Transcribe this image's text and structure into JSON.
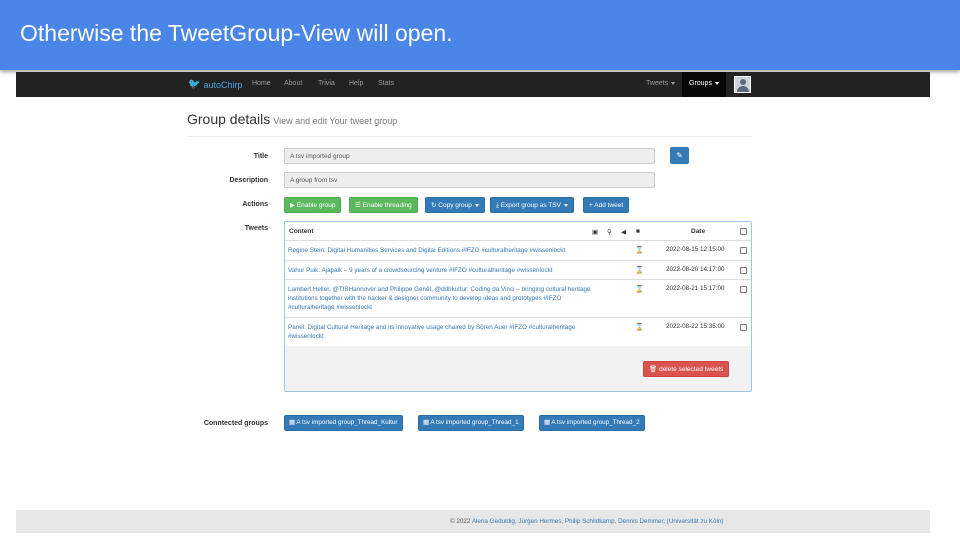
{
  "slide": {
    "title": "Otherwise the TweetGroup-View will open."
  },
  "navbar": {
    "brand": "autoChirp",
    "links": [
      "Home",
      "About",
      "Trivia",
      "Help",
      "Stats"
    ],
    "tweets_menu": "Tweets",
    "groups_menu": "Groups"
  },
  "page": {
    "title": "Group details",
    "subtitle": "View and edit Your tweet group"
  },
  "form": {
    "title_label": "Title",
    "title_value": "A tsv imported group",
    "description_label": "Description",
    "description_value": "A group from tsv",
    "actions_label": "Actions",
    "tweets_label": "Tweets"
  },
  "actions": {
    "enable_group": "Enable group",
    "enable_threading": "Enable threading",
    "copy_group": "Copy group",
    "export_tsv": "Export group as TSV",
    "add_tweet": "Add tweet"
  },
  "tweets_table": {
    "col_content": "Content",
    "col_date": "Date",
    "rows": [
      {
        "content": "Regine Stein: Digital Humanities Services and Digital Editions #IFZO #culturalheritage #wissenlockt",
        "date": "2022-08-15 12:15:00"
      },
      {
        "content": "Vahur Puik: Ajapaik – 9 years of a crowdsourcing venture #IFZO #culturalheritage #wissenlockt",
        "date": "2022-08-20 14:17:00"
      },
      {
        "content": "Lambert Heller, @TIBHannover and Philippe Genêt, @ddbkultur: Coding da Vinci – bringing cultural heritage institutions together with the hacker & designer community to develop ideas and  prototypes #IFZO #culturalheritage #wissenlockt",
        "date": "2022-08-21 15:17:00"
      },
      {
        "content": "Panel: Digital Cultural Heritage and its innovative usage chaired by Sören Auer #IFZO #culturalheritage #wissenlockt",
        "date": "2022-08-22 15:35:00"
      }
    ],
    "delete_button": "delete selected tweets"
  },
  "connected": {
    "label": "Conntected groups",
    "groups": [
      "A tsv imported group_Thread_Kultur",
      "A tsv imported group_Thread_1",
      "A tsv imported group_Thread_2"
    ]
  },
  "footer": {
    "prefix": "© 2022",
    "authors": "Alena Geduldig, Jürgen Hermes, Philip Schildkamp, Dennis Demmer,",
    "institution": "(Universität zu Köln)"
  }
}
